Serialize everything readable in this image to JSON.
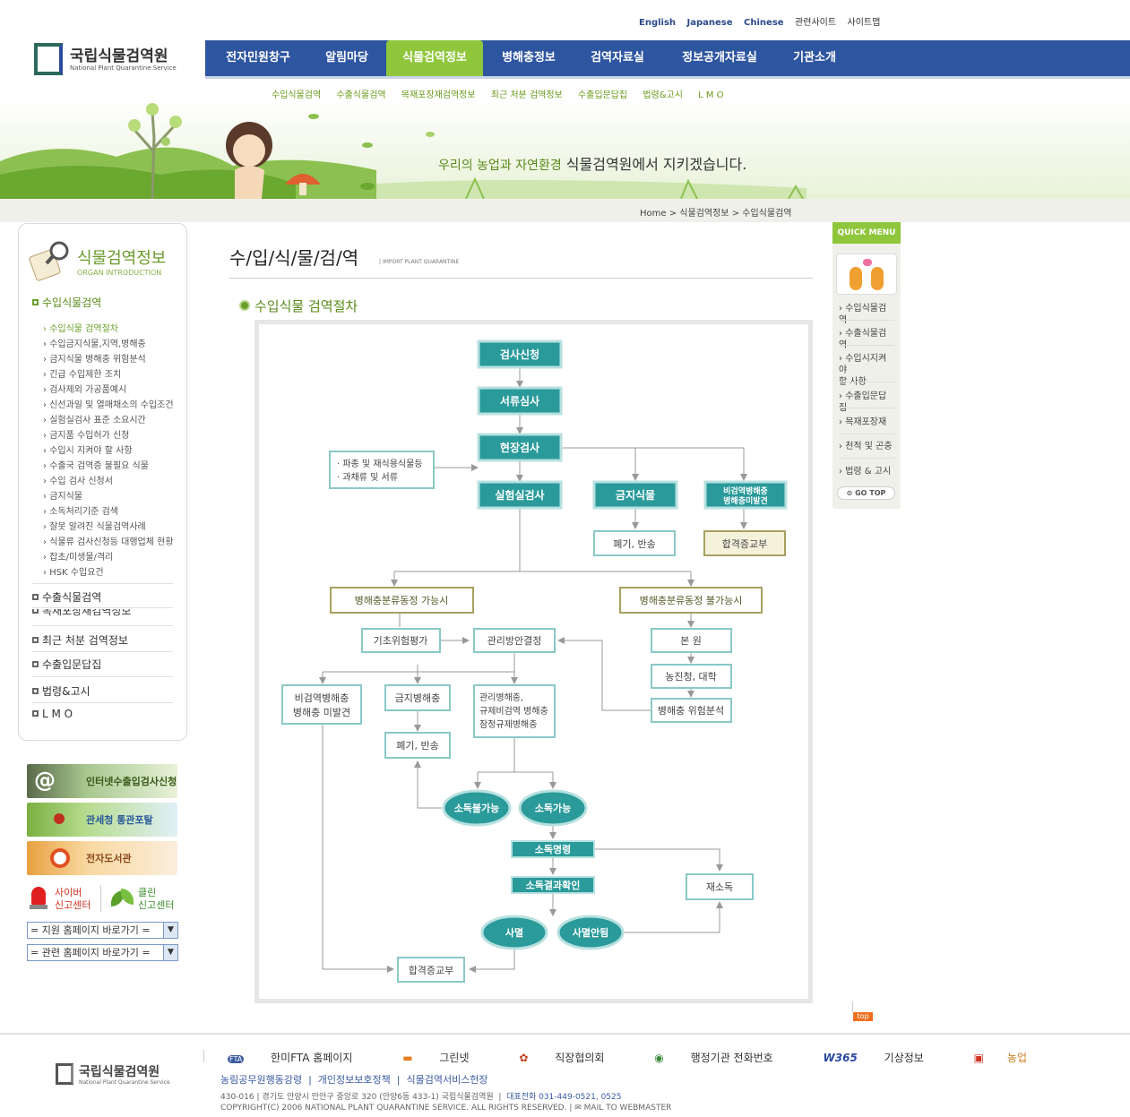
{
  "header": {
    "languages": [
      "English",
      "Japanese",
      "Chinese"
    ],
    "util_links": [
      "관련사이트",
      "사이트맵"
    ],
    "logo_kr": "국립식물검역원",
    "logo_en": "National Plant Quarantine Service"
  },
  "gnb": {
    "items": [
      "전자민원창구",
      "알림마당",
      "식물검역정보",
      "병해충정보",
      "검역자료실",
      "정보공개자료실",
      "기관소개"
    ],
    "active_index": 2
  },
  "snb": {
    "items": [
      "수입식물검역",
      "수출식물검역",
      "목재포장재검역정보",
      "최근 처분 검역정보",
      "수출입문답집",
      "법령&고시",
      "L M O"
    ]
  },
  "visual": {
    "slogan_small": "우리의 농업과 자연환경",
    "slogan_main": "식물검역원에서 지키겠습니다."
  },
  "location": {
    "home": "Home",
    "level1": "식물검역정보",
    "level2": "수입식물검역",
    "sep": ">"
  },
  "lnb": {
    "title": "식물검역정보",
    "subtitle": "ORGAN INTRODUCTION",
    "main_items": [
      "수입식물검역",
      "수출식물검역",
      "목재포장재검역정보",
      "최근 처분 검역정보",
      "수출입문답집",
      "법령&고시",
      "L M O"
    ],
    "sub_items": [
      "수입식물 검역절차",
      "수입금지식물,지역,병해충",
      "금지식물 병해충 위험분석",
      "긴급 수입제한 조치",
      "검사제외 가공품예시",
      "신선과일 및 열매채소의 수입조건",
      "실험실검사 표준 소요시간",
      "금지품 수입허가 신청",
      "수입시 지켜야 할 사항",
      "수출국 검역증 불필요 식물",
      "수입 검사 신청서",
      "금지식물",
      "소독처리기준 검색",
      "잘못 알려진 식물검역사례",
      "식물류 검사신청등 대행업체 현황",
      "잡초/미생물/격리",
      "HSK 수입요건"
    ]
  },
  "banners": {
    "b1": "인터넷수출입검사신청",
    "b2": "관세청 통관포탈",
    "b3": "전자도서관",
    "cyber": "사이버\n신고센터",
    "clean": "클린\n신고센터",
    "select1": "= 지원 홈페이지 바로가기 =",
    "select2": "= 관련 홈페이지 바로가기 ="
  },
  "content": {
    "title": "수/입/식/물/검/역",
    "title_en": "IMPORT PLANT QUARANTINE",
    "section": "수입식물 검역절차"
  },
  "flow": {
    "n1": "검사신청",
    "n2": "서류심사",
    "n3": "현장검사",
    "n4a": "· 파종 및 재식용식물등",
    "n4b": "· 과채류 및 서류",
    "n5": "실험실검사",
    "n6": "금지식물",
    "n7a": "비검역병해충",
    "n7b": "병해충미발견",
    "n8": "폐기, 반송",
    "n9": "합격증교부",
    "n10": "병해충분류동정  가능시",
    "n11": "병해충분류동정 불가능시",
    "n12": "기초위험평가",
    "n13": "관리방안결정",
    "n14": "본  원",
    "n15": "농진청, 대학",
    "n16": "병해충 위험분석",
    "n17a": "비검역병해충",
    "n17b": "병해충 미발견",
    "n18": "금지병해충",
    "n19a": "관리병해충,",
    "n19b": "규제비검역 병해충",
    "n19c": "잠정규제병해충",
    "n20": "폐기, 반송",
    "n21": "소독불가능",
    "n22": "소독가능",
    "n23": "소독명령",
    "n24": "소독결과확인",
    "n25": "재소독",
    "n26": "사멸",
    "n27": "사멸안됨",
    "n28": "합격증교부"
  },
  "quick": {
    "head": "QUICK MENU",
    "items": [
      "수입식물검역",
      "수출식물검역",
      "수입시지켜야\n할 사항",
      "수출입문답집",
      "목재포장재",
      "천적 및 곤충",
      "법령 & 고시"
    ],
    "gotop": "GO TOP"
  },
  "top_button": "top",
  "footer": {
    "logo_kr": "국립식물검역원",
    "logo_en": "National Plant Quarantine Service",
    "links": [
      "한미FTA 홈페이지",
      "그린넷",
      "직장협의회",
      "행정기관 전화번호",
      "기상정보",
      "농업"
    ],
    "link_fta": "FTA",
    "link_w365": "W365",
    "links2": [
      "농림공무원행동강령",
      "개인정보보호정책",
      "식물검역서비스헌장"
    ],
    "address": "430-016  |  경기도 안양시 만안구 중앙로 320 (안양6동 433-1) 국립식물검역원",
    "phone": "대표전화 031-449-0521, 0525",
    "copyright": "COPYRIGHT(C) 2006 NATIONAL PLANT QUARANTINE SERVICE. ALL RIGHTS RESERVED.",
    "mail": "MAIL TO WEBMASTER"
  }
}
